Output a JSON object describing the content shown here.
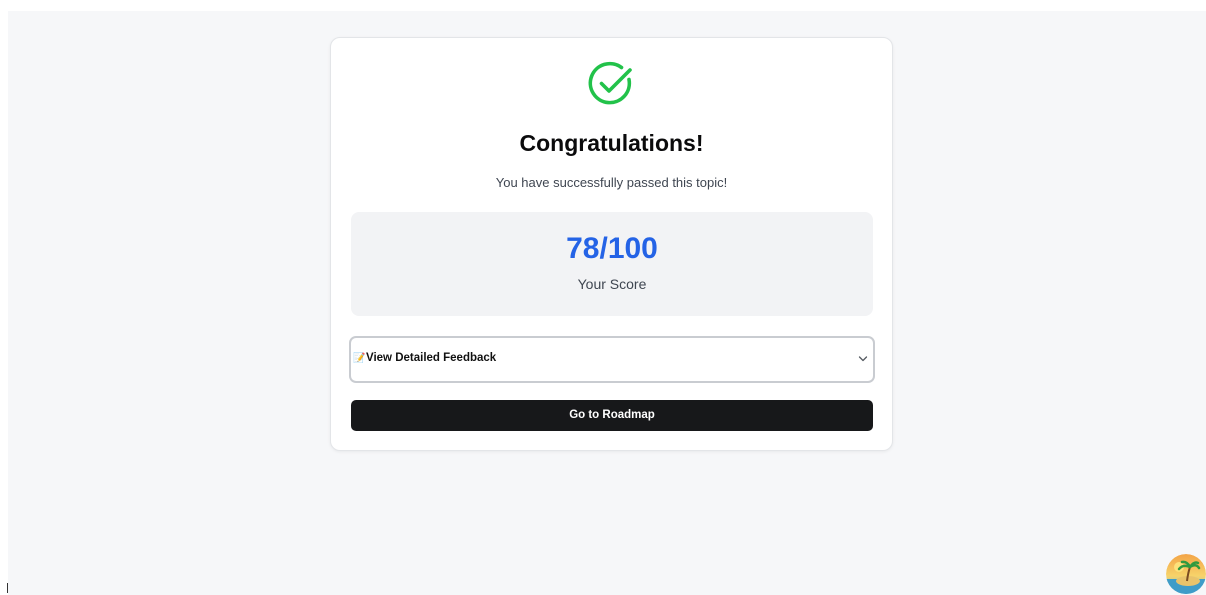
{
  "result": {
    "title": "Congratulations!",
    "message": "You have successfully passed this topic!",
    "icon": "check-circle-icon",
    "icon_color": "#22c24a"
  },
  "score": {
    "value": "78/100",
    "label": "Your Score",
    "color": "#2463e6"
  },
  "feedback": {
    "emoji": "📝",
    "label": "View Detailed Feedback"
  },
  "actions": {
    "roadmap_label": "Go to Roadmap"
  },
  "colors": {
    "page_background": "#f6f7f9",
    "button_background": "#17181a"
  }
}
